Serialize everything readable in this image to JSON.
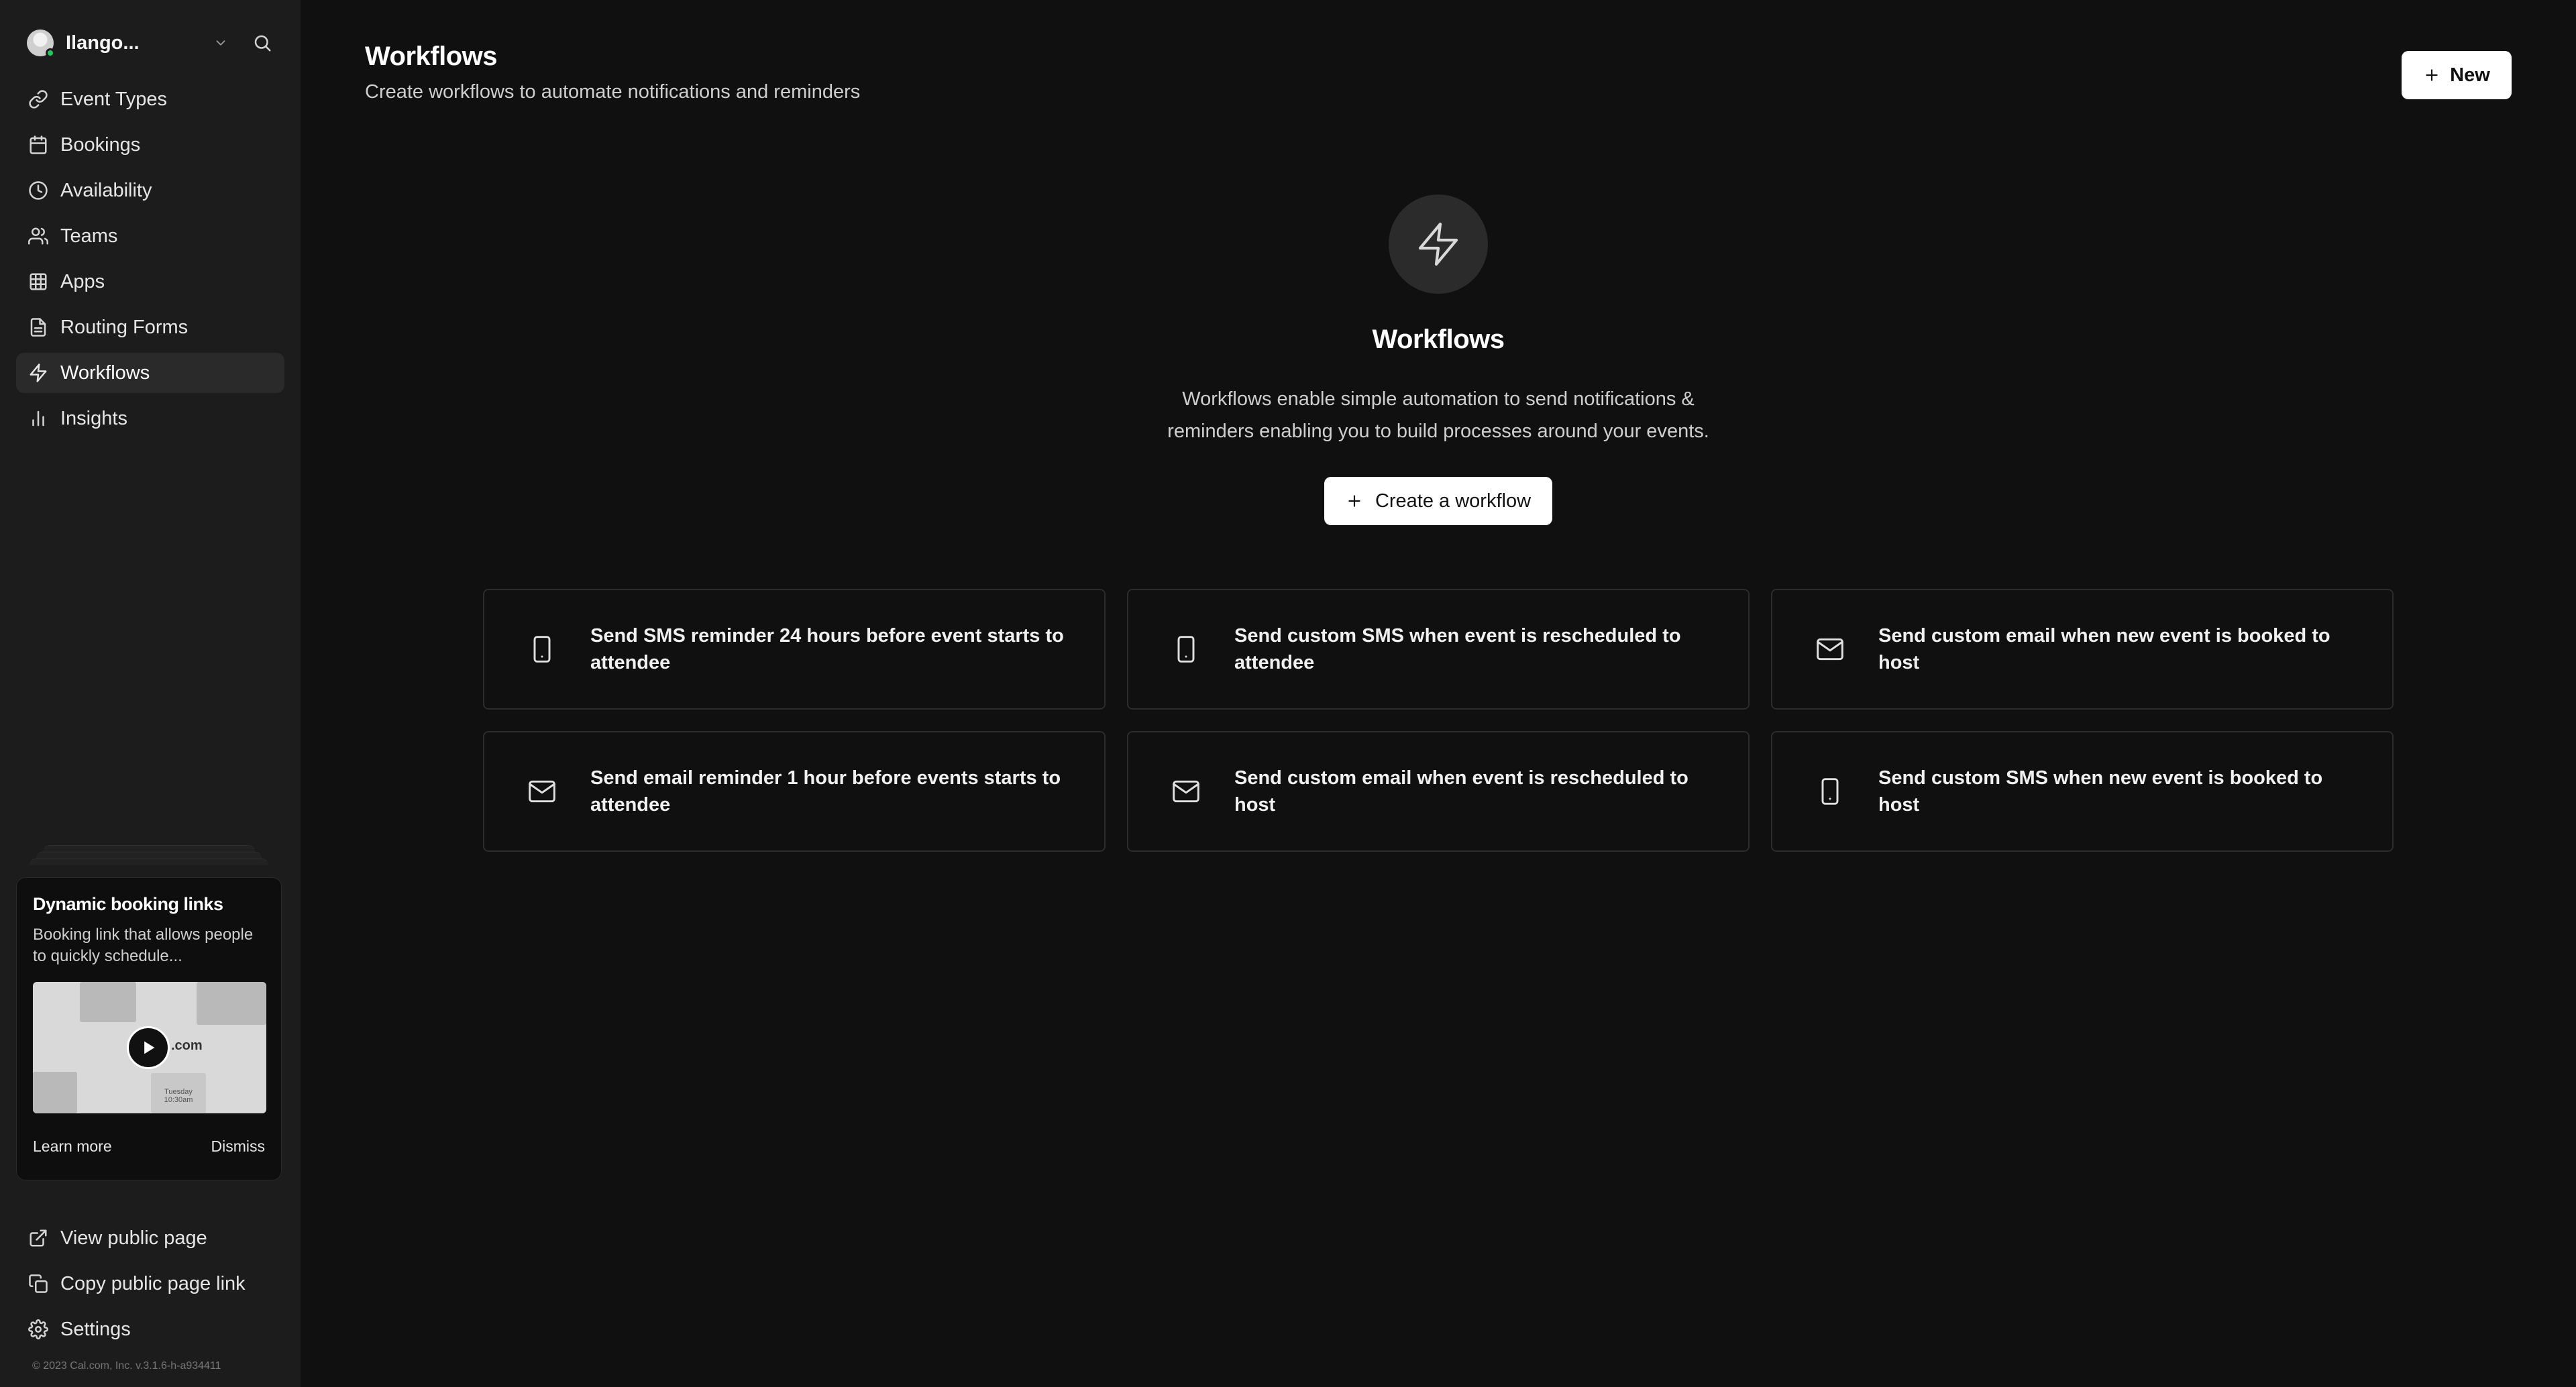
{
  "user": {
    "name": "Ilango..."
  },
  "nav": {
    "items": [
      {
        "label": "Event Types",
        "icon": "link-icon"
      },
      {
        "label": "Bookings",
        "icon": "calendar-icon"
      },
      {
        "label": "Availability",
        "icon": "clock-icon"
      },
      {
        "label": "Teams",
        "icon": "users-icon"
      },
      {
        "label": "Apps",
        "icon": "grid-icon"
      },
      {
        "label": "Routing Forms",
        "icon": "file-icon"
      },
      {
        "label": "Workflows",
        "icon": "zap-icon",
        "active": true
      },
      {
        "label": "Insights",
        "icon": "bar-chart-icon"
      }
    ]
  },
  "promo": {
    "title": "Dynamic booking links",
    "description": "Booking link that allows people to quickly schedule...",
    "thumb_text": ".com",
    "thumb_small_text": "Tuesday 10:30am",
    "learn_more": "Learn more",
    "dismiss": "Dismiss"
  },
  "bottom_nav": {
    "items": [
      {
        "label": "View public page",
        "icon": "external-link-icon"
      },
      {
        "label": "Copy public page link",
        "icon": "copy-icon"
      },
      {
        "label": "Settings",
        "icon": "gear-icon"
      }
    ]
  },
  "copyright": "© 2023 Cal.com, Inc. v.3.1.6-h-a934411",
  "header": {
    "title": "Workflows",
    "subtitle": "Create workflows to automate notifications and reminders",
    "new_button": "New"
  },
  "empty_state": {
    "title": "Workflows",
    "description_line1": "Workflows enable simple automation to send notifications &",
    "description_line2": "reminders enabling you to build processes around your events.",
    "create_button": "Create a workflow"
  },
  "templates": [
    {
      "icon": "smartphone-icon",
      "label": "Send SMS reminder 24 hours before event starts to attendee"
    },
    {
      "icon": "smartphone-icon",
      "label": "Send custom SMS when event is rescheduled to attendee"
    },
    {
      "icon": "mail-icon",
      "label": "Send custom email when new event is booked to host"
    },
    {
      "icon": "mail-icon",
      "label": "Send email reminder 1 hour before events starts to attendee"
    },
    {
      "icon": "mail-icon",
      "label": "Send custom email when event is rescheduled to host"
    },
    {
      "icon": "smartphone-icon",
      "label": "Send custom SMS when new event is booked to host"
    }
  ],
  "colors": {
    "background": "#101010",
    "sidebar": "#1c1c1c",
    "active_nav": "#2a2a2a",
    "button_bg": "#ffffff",
    "status_online": "#22c55e"
  }
}
